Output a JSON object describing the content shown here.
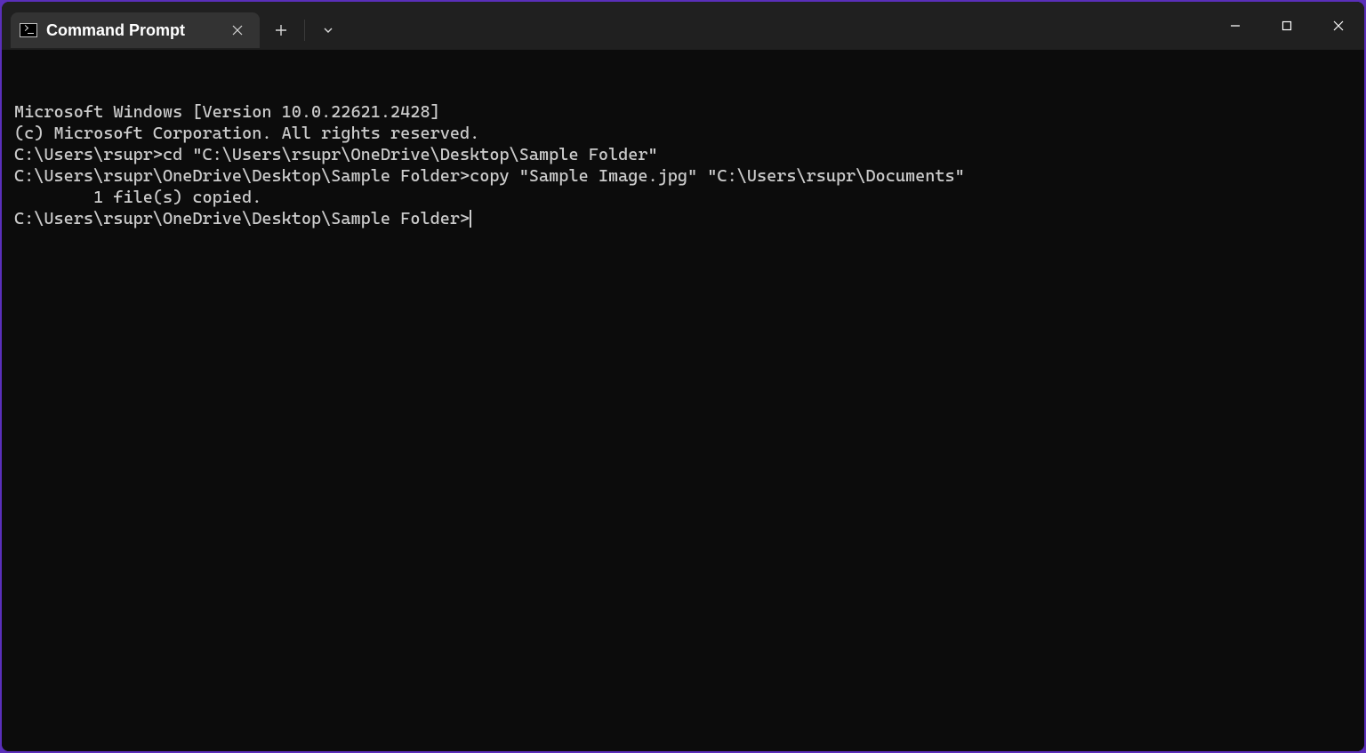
{
  "tab": {
    "title": "Command Prompt"
  },
  "terminal": {
    "lines": [
      "Microsoft Windows [Version 10.0.22621.2428]",
      "(c) Microsoft Corporation. All rights reserved.",
      "",
      "C:\\Users\\rsupr>cd \"C:\\Users\\rsupr\\OneDrive\\Desktop\\Sample Folder\"",
      "",
      "C:\\Users\\rsupr\\OneDrive\\Desktop\\Sample Folder>copy \"Sample Image.jpg\" \"C:\\Users\\rsupr\\Documents\"",
      "        1 file(s) copied.",
      "",
      "C:\\Users\\rsupr\\OneDrive\\Desktop\\Sample Folder>"
    ]
  }
}
